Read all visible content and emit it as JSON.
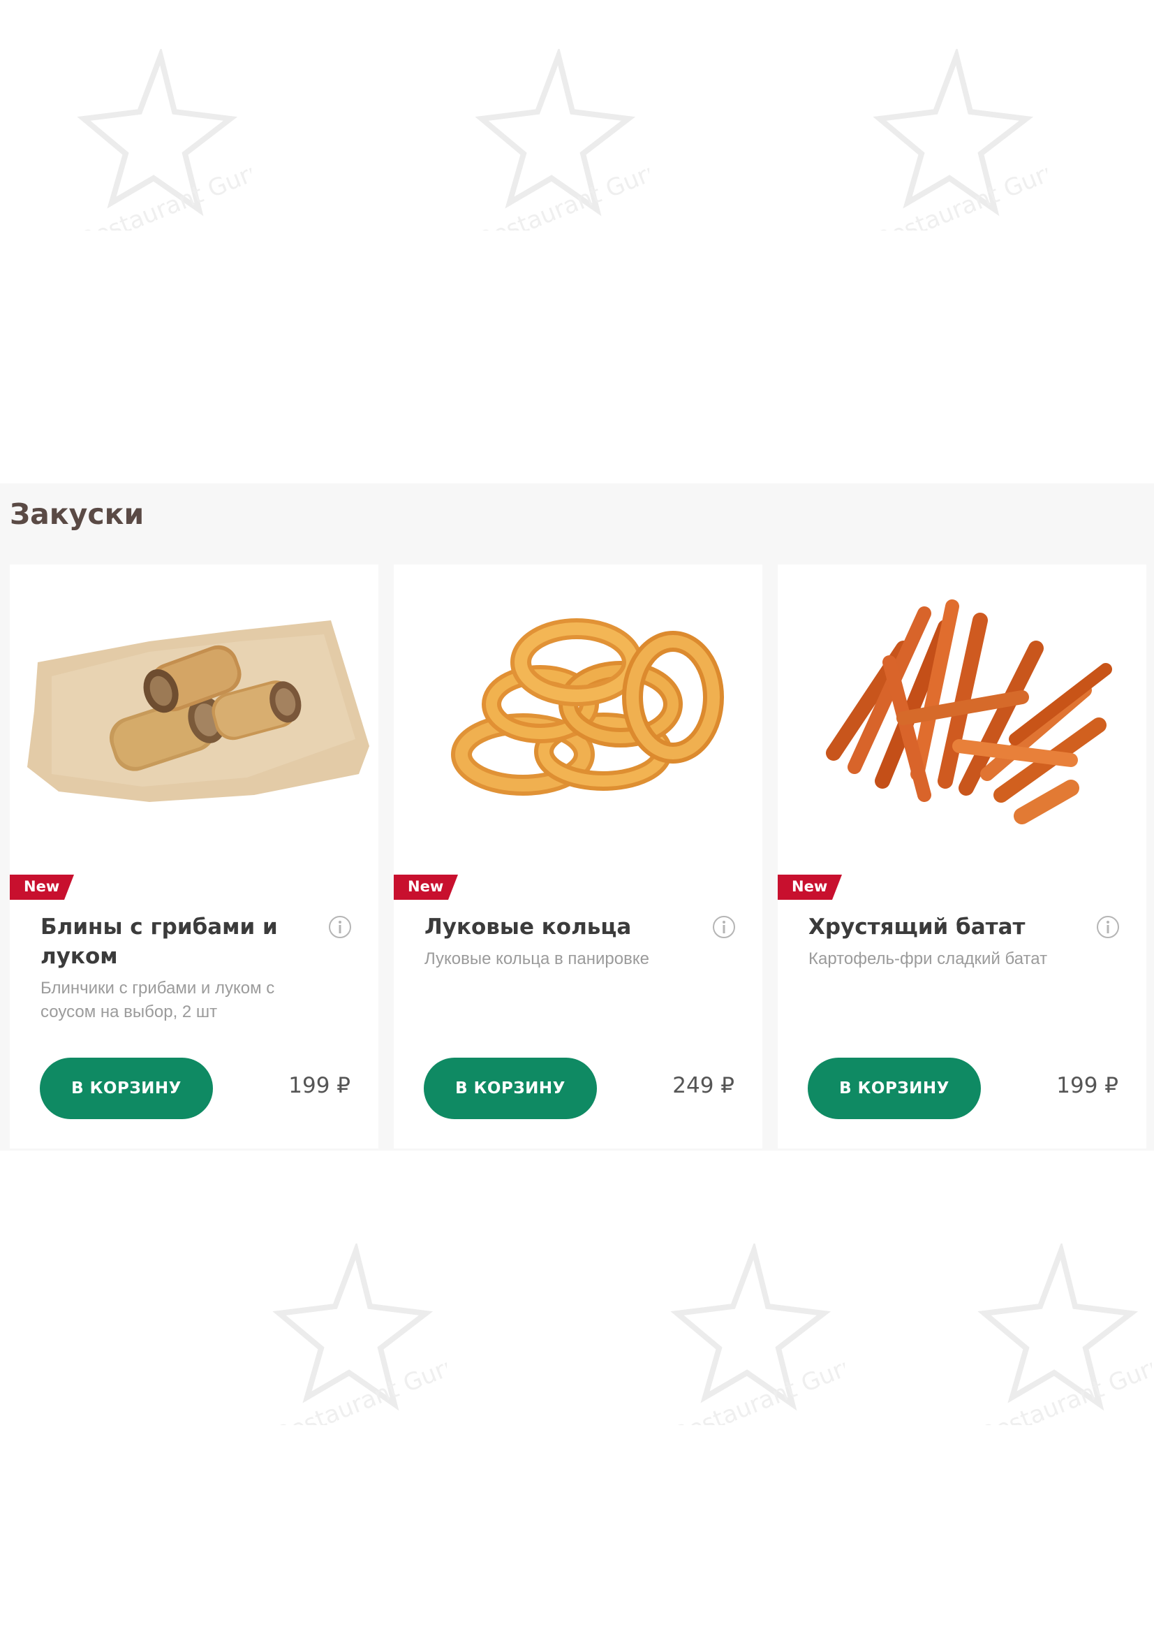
{
  "watermark": {
    "text": "Restaurant Guru"
  },
  "section": {
    "title": "Закуски"
  },
  "products": [
    {
      "badge": "New",
      "title": "Блины с грибами и луком",
      "description": "Блинчики с грибами и луком с соусом на выбор, 2 шт",
      "button_label": "В КОРЗИНУ",
      "price": "199 ₽",
      "image": "pancake-rolls-image"
    },
    {
      "badge": "New",
      "title": "Луковые кольца",
      "description": "Луковые кольца в панировке",
      "button_label": "В КОРЗИНУ",
      "price": "249 ₽",
      "image": "onion-rings-image"
    },
    {
      "badge": "New",
      "title": "Хрустящий батат",
      "description": "Картофель-фри сладкий батат",
      "button_label": "В КОРЗИНУ",
      "price": "199 ₽",
      "image": "sweet-potato-fries-image"
    }
  ],
  "colors": {
    "accent_green": "#0f8a63",
    "badge_red": "#c8102e",
    "title_text": "#5a4a45",
    "section_bg": "#f7f7f7"
  }
}
